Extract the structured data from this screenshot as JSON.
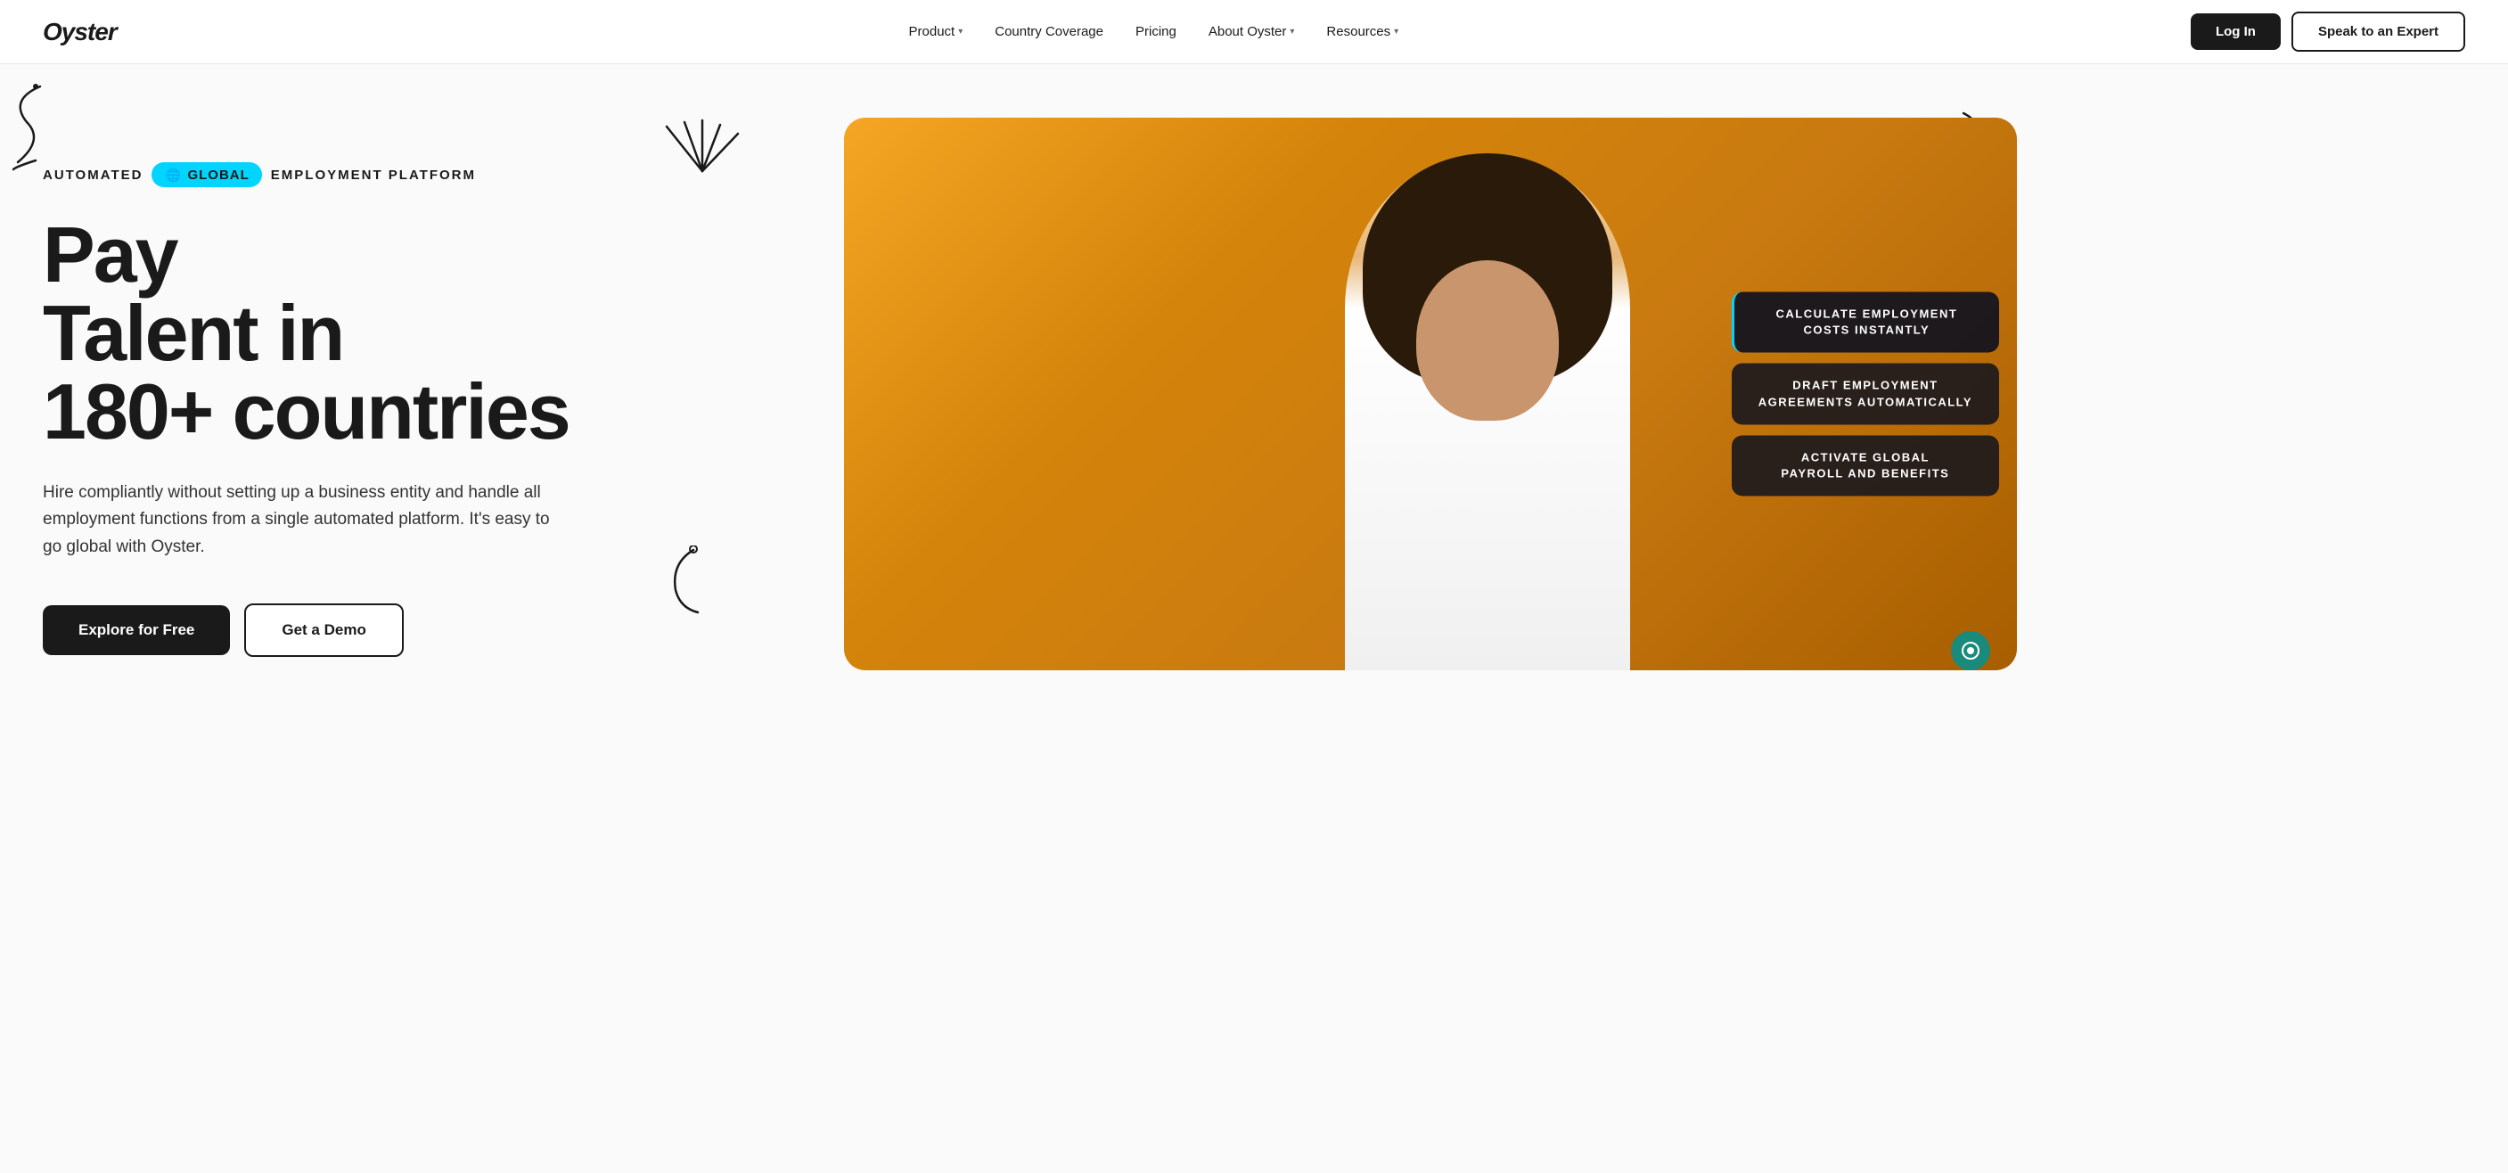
{
  "brand": {
    "logo": "Oyster"
  },
  "nav": {
    "links": [
      {
        "id": "product",
        "label": "Product",
        "has_dropdown": true
      },
      {
        "id": "country-coverage",
        "label": "Country Coverage",
        "has_dropdown": false
      },
      {
        "id": "pricing",
        "label": "Pricing",
        "has_dropdown": false
      },
      {
        "id": "about-oyster",
        "label": "About Oyster",
        "has_dropdown": true
      },
      {
        "id": "resources",
        "label": "Resources",
        "has_dropdown": true
      }
    ],
    "login_label": "Log In",
    "expert_label": "Speak to an Expert"
  },
  "hero": {
    "tag_pre": "AUTOMATED",
    "tag_badge": "GLOBAL",
    "tag_flag": "🌐",
    "tag_post": "EMPLOYMENT PLATFORM",
    "heading_line1": "Pay",
    "heading_line2": "Talent in",
    "heading_line3": "180+ countries",
    "description": "Hire compliantly without setting up a business entity and handle all employment functions from a single automated platform. It's easy to go global with Oyster.",
    "btn_explore": "Explore for Free",
    "btn_demo": "Get a Demo",
    "features": [
      {
        "id": "calc",
        "label": "CALCULATE EMPLOYMENT\nCOSTS INSTANTLY"
      },
      {
        "id": "draft",
        "label": "DRAFT EMPLOYMENT\nAGREEMENTS AUTOMATICALLY"
      },
      {
        "id": "activate",
        "label": "ACTIVATE GLOBAL\nPAYROLL AND BENEFITS"
      }
    ]
  }
}
